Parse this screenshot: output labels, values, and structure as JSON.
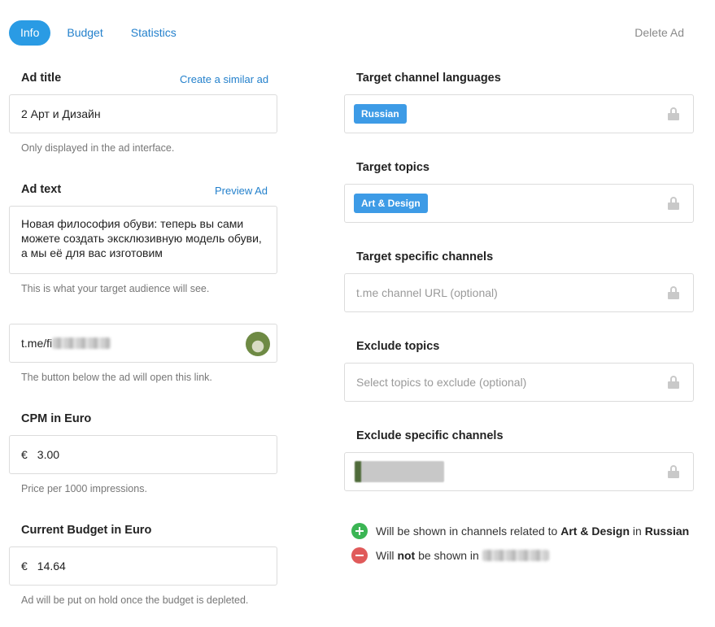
{
  "tabs": {
    "info": "Info",
    "budget": "Budget",
    "statistics": "Statistics"
  },
  "delete_ad": "Delete Ad",
  "ad_title": {
    "label": "Ad title",
    "link": "Create a similar ad",
    "value": "2 Арт и Дизайн",
    "hint": "Only displayed in the ad interface."
  },
  "ad_text": {
    "label": "Ad text",
    "link": "Preview Ad",
    "value": "Новая философия обуви: теперь вы сами можете создать эксклюзивную модель обуви, а мы её для вас изготовим",
    "hint": "This is what your target audience will see."
  },
  "ad_link": {
    "value_prefix": "t.me/fi",
    "hint": "The button below the ad will open this link."
  },
  "cpm": {
    "label": "CPM in Euro",
    "currency": "€",
    "value": "3.00",
    "hint": "Price per 1000 impressions."
  },
  "budget": {
    "label": "Current Budget in Euro",
    "currency": "€",
    "value": "14.64",
    "hint": "Ad will be put on hold once the budget is depleted."
  },
  "target_languages": {
    "label": "Target channel languages",
    "tags": [
      "Russian"
    ]
  },
  "target_topics": {
    "label": "Target topics",
    "tags": [
      "Art & Design"
    ]
  },
  "target_channels": {
    "label": "Target specific channels",
    "placeholder": "t.me channel URL (optional)"
  },
  "exclude_topics": {
    "label": "Exclude topics",
    "placeholder": "Select topics to exclude (optional)"
  },
  "exclude_channels": {
    "label": "Exclude specific channels"
  },
  "summary": {
    "shown_prefix": "Will be shown in channels related to",
    "shown_topic": "Art & Design",
    "shown_in": "in",
    "shown_language": "Russian",
    "not_shown_pre": "Will",
    "not_shown_not": "not",
    "not_shown_post": "be shown in"
  },
  "colors": {
    "accent": "#2a9be4",
    "link": "#2481cc",
    "tag": "#3d9be6",
    "positive": "#3bb554",
    "negative": "#e05a5a"
  }
}
